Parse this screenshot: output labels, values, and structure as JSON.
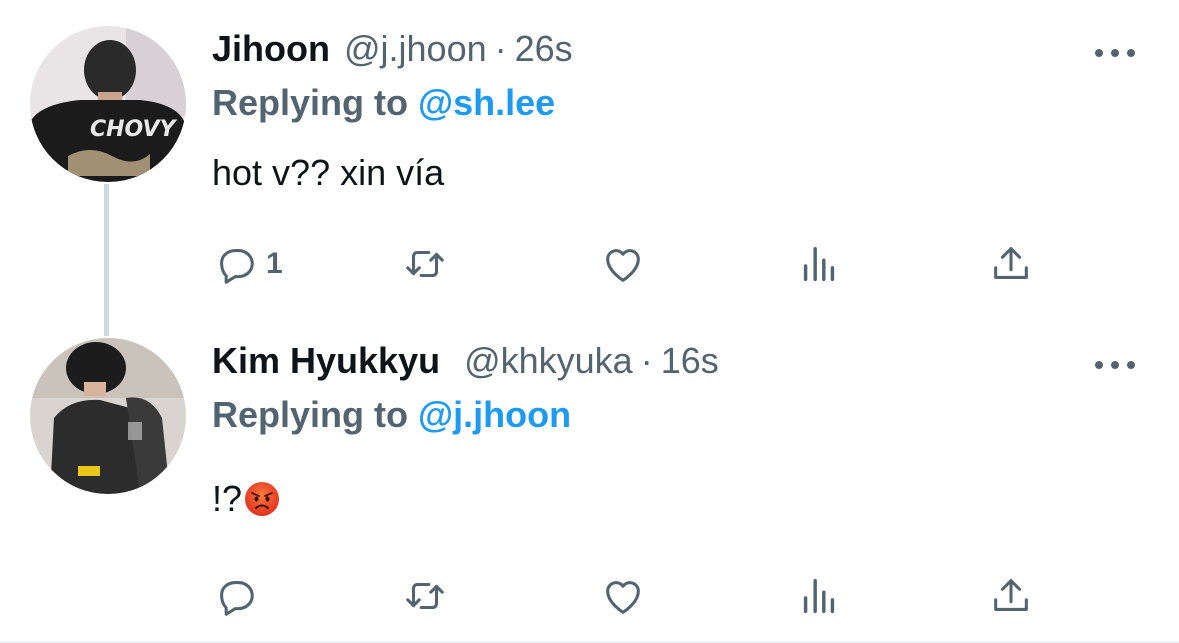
{
  "colors": {
    "accent": "#1d9bf0",
    "text": "#0f1419",
    "secondary": "#536471",
    "thread_line": "#cfd9de"
  },
  "tweets": [
    {
      "name": "Jihoon",
      "handle": "@j.jhoon",
      "separator": "·",
      "time": "26s",
      "replying_prefix": "Replying to",
      "replying_to": "@sh.lee",
      "text": "hot v?? xin vía",
      "avatar_shirt_text": "CHOVY",
      "actions": {
        "reply_count": "1",
        "retweet_count": "",
        "like_count": "",
        "views_count": ""
      },
      "icons": [
        "reply-icon",
        "retweet-icon",
        "like-icon",
        "views-icon",
        "share-icon",
        "more-icon"
      ]
    },
    {
      "name": "Kim Hyukkyu",
      "handle": "@khkyuka",
      "separator": "·",
      "time": "16s",
      "replying_prefix": "Replying to",
      "replying_to": "@j.jhoon",
      "text": "!?",
      "emoji": "angry-face-emoji",
      "actions": {
        "reply_count": "",
        "retweet_count": "",
        "like_count": "",
        "views_count": ""
      },
      "icons": [
        "reply-icon",
        "retweet-icon",
        "like-icon",
        "views-icon",
        "share-icon",
        "more-icon"
      ]
    }
  ]
}
